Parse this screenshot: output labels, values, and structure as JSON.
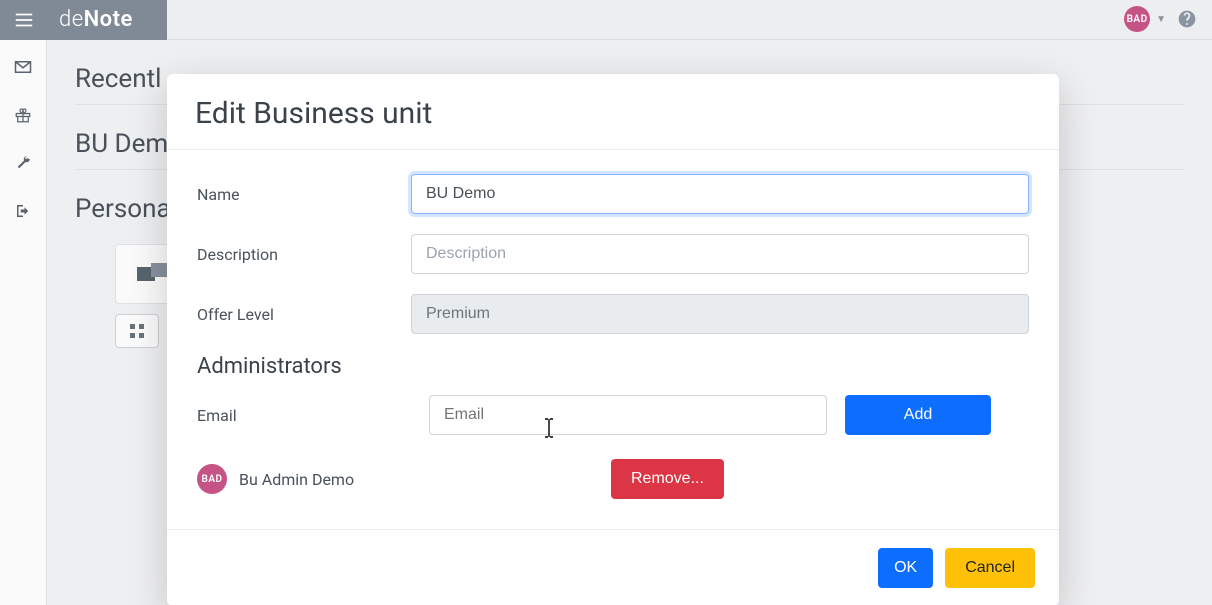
{
  "brand": {
    "prefix": "de",
    "bold": "Note"
  },
  "topbar": {
    "user_initials": "BAD"
  },
  "rail": {
    "items": [
      {
        "name": "mail-icon"
      },
      {
        "name": "gift-icon"
      },
      {
        "name": "wrench-icon"
      },
      {
        "name": "exit-icon"
      }
    ]
  },
  "page": {
    "heading_recent": "Recentl",
    "heading_bu": "BU Dem",
    "heading_personal": "Persona"
  },
  "modal": {
    "title": "Edit Business unit",
    "labels": {
      "name": "Name",
      "description": "Description",
      "offer_level": "Offer Level",
      "email": "Email"
    },
    "placeholders": {
      "description": "Description",
      "email": "Email"
    },
    "values": {
      "name": "BU Demo",
      "offer_level": "Premium"
    },
    "section_admins": "Administrators",
    "buttons": {
      "add": "Add",
      "remove": "Remove...",
      "ok": "OK",
      "cancel": "Cancel"
    },
    "admins": [
      {
        "initials": "BAD",
        "name": "Bu Admin Demo"
      }
    ]
  }
}
